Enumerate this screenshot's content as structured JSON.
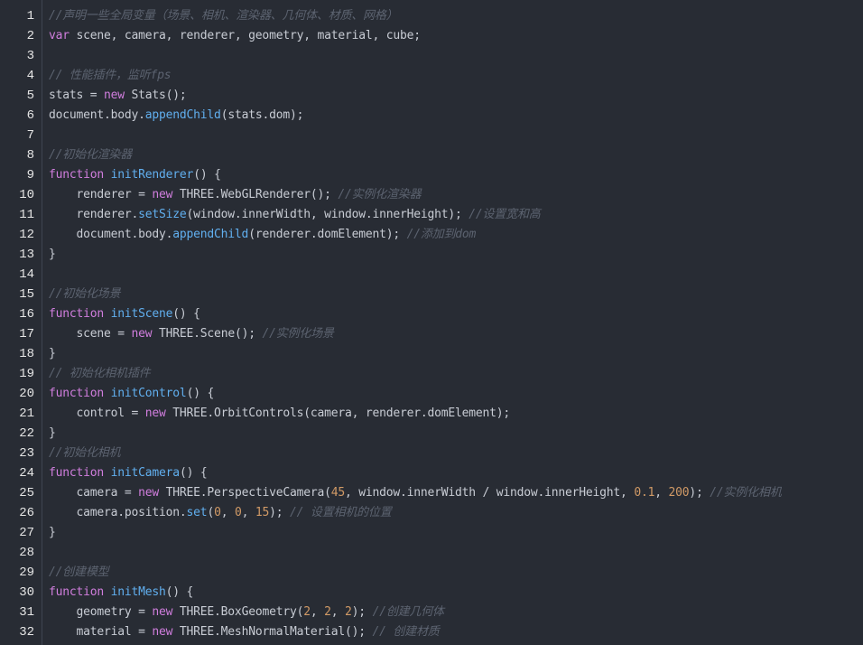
{
  "colors": {
    "background": "#282c34",
    "line_number": "#e6e6e6",
    "plain": "#c8ccd4",
    "keyword": "#d17ede",
    "function": "#61afef",
    "number": "#d19a66",
    "comment": "#5c6370"
  },
  "lines": [
    {
      "n": "1",
      "tokens": [
        [
          "cmt",
          "//声明一些全局变量（场景、相机、渲染器、几何体、材质、网格）"
        ]
      ]
    },
    {
      "n": "2",
      "tokens": [
        [
          "kw",
          "var"
        ],
        [
          "plain",
          " scene, camera, renderer, geometry, material, cube;"
        ]
      ]
    },
    {
      "n": "3",
      "tokens": []
    },
    {
      "n": "4",
      "tokens": [
        [
          "cmt",
          "// 性能插件，监听fps"
        ]
      ]
    },
    {
      "n": "5",
      "tokens": [
        [
          "plain",
          "stats = "
        ],
        [
          "kw",
          "new"
        ],
        [
          "plain",
          " Stats();"
        ]
      ]
    },
    {
      "n": "6",
      "tokens": [
        [
          "plain",
          "document.body."
        ],
        [
          "fn",
          "appendChild"
        ],
        [
          "plain",
          "(stats.dom);"
        ]
      ]
    },
    {
      "n": "7",
      "tokens": []
    },
    {
      "n": "8",
      "tokens": [
        [
          "cmt",
          "//初始化渲染器"
        ]
      ]
    },
    {
      "n": "9",
      "tokens": [
        [
          "kw",
          "function"
        ],
        [
          "plain",
          " "
        ],
        [
          "fn",
          "initRenderer"
        ],
        [
          "plain",
          "() {"
        ]
      ]
    },
    {
      "n": "10",
      "tokens": [
        [
          "plain",
          "    renderer = "
        ],
        [
          "kw",
          "new"
        ],
        [
          "plain",
          " THREE.WebGLRenderer(); "
        ],
        [
          "cmt",
          "//实例化渲染器"
        ]
      ]
    },
    {
      "n": "11",
      "tokens": [
        [
          "plain",
          "    renderer."
        ],
        [
          "fn",
          "setSize"
        ],
        [
          "plain",
          "(window.innerWidth, window.innerHeight); "
        ],
        [
          "cmt",
          "//设置宽和高"
        ]
      ]
    },
    {
      "n": "12",
      "tokens": [
        [
          "plain",
          "    document.body."
        ],
        [
          "fn",
          "appendChild"
        ],
        [
          "plain",
          "(renderer.domElement); "
        ],
        [
          "cmt",
          "//添加到dom"
        ]
      ]
    },
    {
      "n": "13",
      "tokens": [
        [
          "plain",
          "}"
        ]
      ]
    },
    {
      "n": "14",
      "tokens": []
    },
    {
      "n": "15",
      "tokens": [
        [
          "cmt",
          "//初始化场景"
        ]
      ]
    },
    {
      "n": "16",
      "tokens": [
        [
          "kw",
          "function"
        ],
        [
          "plain",
          " "
        ],
        [
          "fn",
          "initScene"
        ],
        [
          "plain",
          "() {"
        ]
      ]
    },
    {
      "n": "17",
      "tokens": [
        [
          "plain",
          "    scene = "
        ],
        [
          "kw",
          "new"
        ],
        [
          "plain",
          " THREE.Scene(); "
        ],
        [
          "cmt",
          "//实例化场景"
        ]
      ]
    },
    {
      "n": "18",
      "tokens": [
        [
          "plain",
          "}"
        ]
      ]
    },
    {
      "n": "19",
      "tokens": [
        [
          "cmt",
          "// 初始化相机插件"
        ]
      ]
    },
    {
      "n": "20",
      "tokens": [
        [
          "kw",
          "function"
        ],
        [
          "plain",
          " "
        ],
        [
          "fn",
          "initControl"
        ],
        [
          "plain",
          "() {"
        ]
      ]
    },
    {
      "n": "21",
      "tokens": [
        [
          "plain",
          "    control = "
        ],
        [
          "kw",
          "new"
        ],
        [
          "plain",
          " THREE.OrbitControls(camera, renderer.domElement);"
        ]
      ]
    },
    {
      "n": "22",
      "tokens": [
        [
          "plain",
          "}"
        ]
      ]
    },
    {
      "n": "23",
      "tokens": [
        [
          "cmt",
          "//初始化相机"
        ]
      ]
    },
    {
      "n": "24",
      "tokens": [
        [
          "kw",
          "function"
        ],
        [
          "plain",
          " "
        ],
        [
          "fn",
          "initCamera"
        ],
        [
          "plain",
          "() {"
        ]
      ]
    },
    {
      "n": "25",
      "tokens": [
        [
          "plain",
          "    camera = "
        ],
        [
          "kw",
          "new"
        ],
        [
          "plain",
          " THREE.PerspectiveCamera("
        ],
        [
          "num",
          "45"
        ],
        [
          "plain",
          ", window.innerWidth / window.innerHeight, "
        ],
        [
          "num",
          "0.1"
        ],
        [
          "plain",
          ", "
        ],
        [
          "num",
          "200"
        ],
        [
          "plain",
          "); "
        ],
        [
          "cmt",
          "//实例化相机"
        ]
      ]
    },
    {
      "n": "26",
      "tokens": [
        [
          "plain",
          "    camera.position."
        ],
        [
          "fn",
          "set"
        ],
        [
          "plain",
          "("
        ],
        [
          "num",
          "0"
        ],
        [
          "plain",
          ", "
        ],
        [
          "num",
          "0"
        ],
        [
          "plain",
          ", "
        ],
        [
          "num",
          "15"
        ],
        [
          "plain",
          "); "
        ],
        [
          "cmt",
          "// 设置相机的位置"
        ]
      ]
    },
    {
      "n": "27",
      "tokens": [
        [
          "plain",
          "}"
        ]
      ]
    },
    {
      "n": "28",
      "tokens": []
    },
    {
      "n": "29",
      "tokens": [
        [
          "cmt",
          "//创建模型"
        ]
      ]
    },
    {
      "n": "30",
      "tokens": [
        [
          "kw",
          "function"
        ],
        [
          "plain",
          " "
        ],
        [
          "fn",
          "initMesh"
        ],
        [
          "plain",
          "() {"
        ]
      ]
    },
    {
      "n": "31",
      "tokens": [
        [
          "plain",
          "    geometry = "
        ],
        [
          "kw",
          "new"
        ],
        [
          "plain",
          " THREE.BoxGeometry("
        ],
        [
          "num",
          "2"
        ],
        [
          "plain",
          ", "
        ],
        [
          "num",
          "2"
        ],
        [
          "plain",
          ", "
        ],
        [
          "num",
          "2"
        ],
        [
          "plain",
          "); "
        ],
        [
          "cmt",
          "//创建几何体"
        ]
      ]
    },
    {
      "n": "32",
      "tokens": [
        [
          "plain",
          "    material = "
        ],
        [
          "kw",
          "new"
        ],
        [
          "plain",
          " THREE.MeshNormalMaterial(); "
        ],
        [
          "cmt",
          "// 创建材质"
        ]
      ]
    }
  ]
}
